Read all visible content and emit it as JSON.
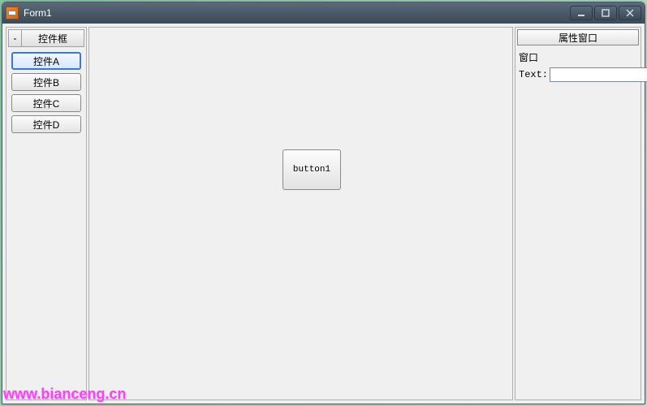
{
  "window": {
    "title": "Form1",
    "title_center": ""
  },
  "win_controls": {
    "minimize": "minimize-icon",
    "maximize": "maximize-icon",
    "close": "close-icon"
  },
  "toolbox": {
    "toggle_symbol": "-",
    "header": "控件框",
    "items": [
      {
        "label": "控件A",
        "selected": true
      },
      {
        "label": "控件B",
        "selected": false
      },
      {
        "label": "控件C",
        "selected": false
      },
      {
        "label": "控件D",
        "selected": false
      }
    ]
  },
  "canvas": {
    "placed_button_label": "button1"
  },
  "properties": {
    "header": "属性窗口",
    "object_label": "窗口",
    "text_label": "Text:",
    "text_value": ""
  },
  "watermark": "www.bianceng.cn"
}
